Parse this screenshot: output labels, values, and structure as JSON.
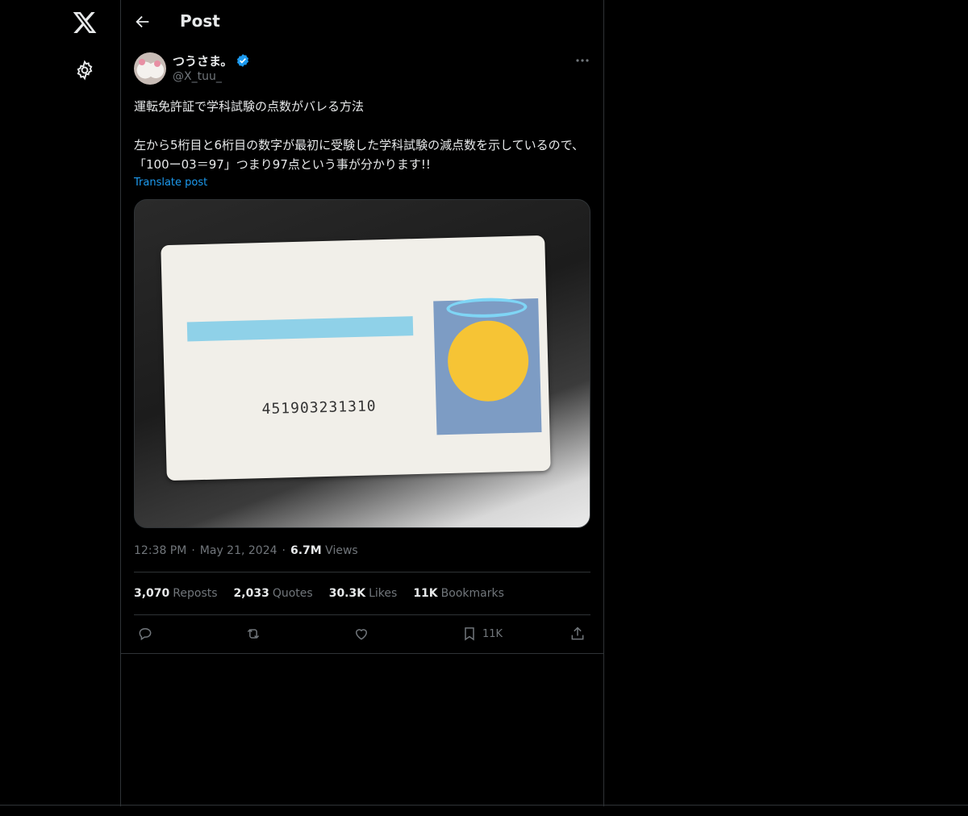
{
  "header": {
    "title": "Post"
  },
  "author": {
    "display_name": "つうさま。",
    "handle": "@X_tuu_"
  },
  "post": {
    "text_line1": "運転免許証で学科試験の点数がバレる方法",
    "text_line2": "左から5桁目と6桁目の数字が最初に受験した学科試験の減点数を示しているので、「100ー03＝97」つまり97点という事が分かります!!",
    "translate_label": "Translate post",
    "time": "12:38 PM",
    "date": "May 21, 2024",
    "views_count": "6.7M",
    "views_label": "Views"
  },
  "media": {
    "license_number": "451903231310"
  },
  "stats": {
    "reposts_count": "3,070",
    "reposts_label": "Reposts",
    "quotes_count": "2,033",
    "quotes_label": "Quotes",
    "likes_count": "30.3K",
    "likes_label": "Likes",
    "bookmarks_count": "11K",
    "bookmarks_label": "Bookmarks"
  },
  "actions": {
    "bookmark_count": "11K"
  },
  "colors": {
    "accent": "#1d9bf0",
    "text": "#e7e9ea",
    "muted": "#71767b",
    "border": "#2f3336",
    "background": "#000000"
  },
  "icons": [
    "x-logo-icon",
    "gear-icon",
    "back-arrow-icon",
    "verified-icon",
    "more-icon",
    "reply-icon",
    "repost-icon",
    "like-icon",
    "bookmark-icon",
    "share-icon"
  ]
}
